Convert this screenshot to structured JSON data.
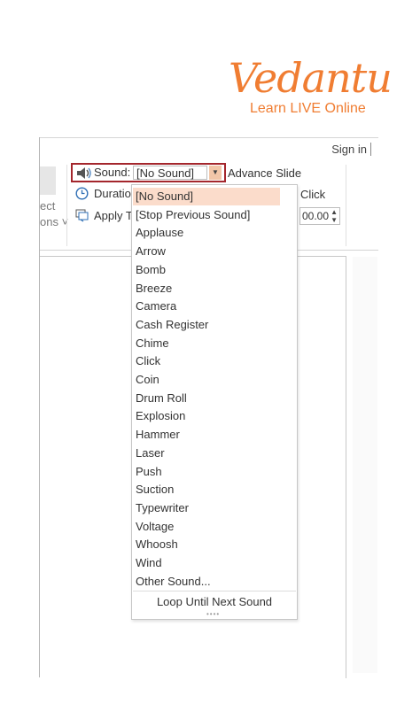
{
  "logo": {
    "name": "Vedantu",
    "tagline": "Learn LIVE Online"
  },
  "titlebar": {
    "sign_in": "Sign in"
  },
  "ribbon": {
    "effect_label_1": "ect",
    "effect_label_2": "ons ˅",
    "sound_label": "Sound:",
    "sound_value": "[No Sound]",
    "advance_label": "Advance Slide",
    "duration_label": "Duratio",
    "apply_label": "Apply T",
    "click_label": "Click",
    "time_value": "00.00"
  },
  "sound_dropdown": {
    "items": [
      "[No Sound]",
      "[Stop Previous Sound]",
      "Applause",
      "Arrow",
      "Bomb",
      "Breeze",
      "Camera",
      "Cash Register",
      "Chime",
      "Click",
      "Coin",
      "Drum Roll",
      "Explosion",
      "Hammer",
      "Laser",
      "Push",
      "Suction",
      "Typewriter",
      "Voltage",
      "Whoosh",
      "Wind",
      "Other Sound..."
    ],
    "selected_index": 0,
    "loop_label": "Loop Until Next Sound"
  },
  "colors": {
    "brand": "#f07d32",
    "highlight_border": "#a4262c",
    "selected_bg": "#fbdccb"
  }
}
